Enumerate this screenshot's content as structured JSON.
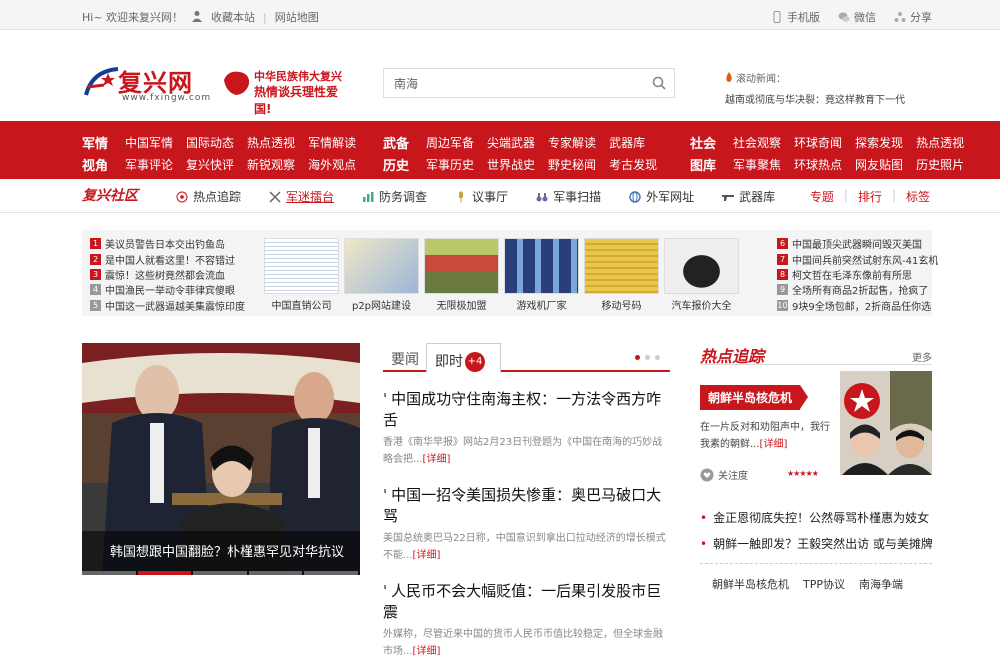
{
  "topbar": {
    "greeting": "Hi~ 欢迎来复兴网！",
    "favorite": "收藏本站",
    "sitemap": "网站地图",
    "mobile": "手机版",
    "wechat": "微信",
    "share": "分享"
  },
  "header": {
    "logo_text": "复兴网",
    "logo_url": "www.fxingw.com",
    "slogan_line1": "中华民族伟大复兴",
    "slogan_line2": "热情谈兵理性爱国!",
    "search_value": "南海",
    "rolling_label": "滚动新闻：",
    "rolling_text": "越南或彻底与华决裂：竟这样教育下一代"
  },
  "rednav": [
    {
      "rows": [
        {
          "cat": "军情",
          "items": [
            "中国军情",
            "国际动态",
            "热点透视",
            "军情解读"
          ]
        },
        {
          "cat": "视角",
          "items": [
            "军事评论",
            "复兴快评",
            "新锐观察",
            "海外观点"
          ]
        }
      ]
    },
    {
      "rows": [
        {
          "cat": "武备",
          "items": [
            "周边军备",
            "尖端武器",
            "专家解读",
            "武器库"
          ]
        },
        {
          "cat": "历史",
          "items": [
            "军事历史",
            "世界战史",
            "野史秘闻",
            "考古发现"
          ]
        }
      ]
    },
    {
      "rows": [
        {
          "cat": "社会",
          "items": [
            "社会观察",
            "环球奇闻",
            "探索发现",
            "热点透视"
          ]
        },
        {
          "cat": "图库",
          "items": [
            "军事聚焦",
            "环球热点",
            "网友贴图",
            "历史照片"
          ]
        }
      ]
    }
  ],
  "subnav": {
    "brand": "复兴社区",
    "items": [
      {
        "label": "热点追踪",
        "icon": "broadcast-icon"
      },
      {
        "label": "军迷擂台",
        "icon": "swords-icon"
      },
      {
        "label": "防务调查",
        "icon": "chart-icon"
      },
      {
        "label": "议事厅",
        "icon": "microphone-icon"
      },
      {
        "label": "军事扫描",
        "icon": "binoculars-icon"
      },
      {
        "label": "外军网址",
        "icon": "globe-icon"
      },
      {
        "label": "武器库",
        "icon": "gun-icon"
      }
    ],
    "right": [
      "专题",
      "排行",
      "标签"
    ]
  },
  "ticker": {
    "left": [
      {
        "n": "1",
        "text": "美议员警告日本交出钓鱼岛"
      },
      {
        "n": "2",
        "text": "是中国人就看这里！不容错过"
      },
      {
        "n": "3",
        "text": "震惊！这些树竟然都会流血"
      },
      {
        "n": "4",
        "text": "中国渔民一举动令菲律宾傻眼"
      },
      {
        "n": "5",
        "text": "中国这一武器逼越美集震惊印度"
      }
    ],
    "right": [
      {
        "n": "6",
        "text": "中国最顶尖武器瞬间毁灭美国"
      },
      {
        "n": "7",
        "text": "中国间兵前突然试射东风-41玄机"
      },
      {
        "n": "8",
        "text": "柯文哲在毛泽东像前有所思"
      },
      {
        "n": "9",
        "text": "全场所有商品2折起售，抢疯了"
      },
      {
        "n": "10",
        "text": "9块9全场包邮，2折商品任你选"
      }
    ],
    "thumbs": [
      "中国直销公司",
      "p2p网站建设",
      "无限极加盟",
      "游戏机厂家",
      "移动号码",
      "汽车报价大全"
    ]
  },
  "slide": {
    "caption": "韩国想跟中国翻脸？朴槿惠罕见对华抗议"
  },
  "news": {
    "tab1": "要闻",
    "tab2": "即时",
    "badge": "+4",
    "articles": [
      {
        "title": "中国成功守住南海主权：一方法令西方咋舌",
        "desc": "香港《南华早报》网站2月23日刊登题为《中国在南海的巧妙战略会把...",
        "more": "[详细]"
      },
      {
        "title": "中国一招令美国损失惨重：奥巴马破口大骂",
        "desc": "美国总统奥巴马22日称，中国意识到拿出口拉动经济的增长模式不能...",
        "more": "[详细]"
      },
      {
        "title": "人民币不会大幅贬值：一后果引发股市巨震",
        "desc": "外媒称，尽管近来中国的货币人民币币值比较稳定，但全球金融市场...",
        "more": "[详细]"
      }
    ]
  },
  "side": {
    "title": "热点追踪",
    "more": "更多",
    "topic": "朝鲜半岛核危机",
    "topic_desc": "在一片反对和劝阻声中，我行我素的朝鲜...",
    "topic_more": "[详细]",
    "attention_label": "关注度",
    "stars": "★★★★★",
    "list": [
      "金正恩彻底失控！公然辱骂朴槿惠为妓女",
      "朝鲜一触即发？王毅突然出访 或与美摊牌"
    ],
    "tags": [
      "朝鲜半岛核危机",
      "TPP协议",
      "南海争端"
    ]
  },
  "colors": {
    "brand_red": "#c8161d",
    "ticker_bg": "#f4f4f4"
  }
}
